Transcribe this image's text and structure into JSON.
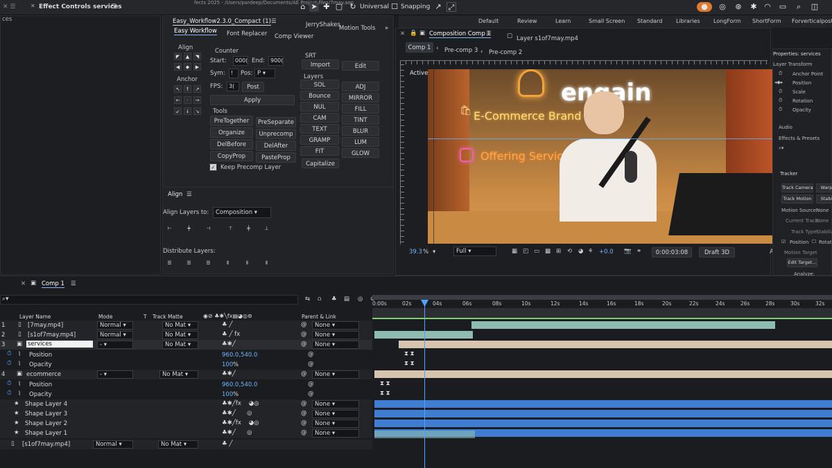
{
  "topbar": {
    "panel_title": "Effect Controls services",
    "tools": [
      "selection-tool",
      "hand-tool",
      "zoom-tool",
      "orbit-tool",
      "pen-tool",
      "rect-tool"
    ],
    "universal": "Universal",
    "snapping": "Snapping",
    "path": "fects 2025 - /Users/pardeep/Documents/AE Project files/7may.aep",
    "effects_left": "ces"
  },
  "workspaces": [
    "Default",
    "Review",
    "Learn",
    "Small Screen",
    "Standard",
    "Libraries",
    "LongForm",
    "ShortForm",
    "Forverticalpost"
  ],
  "workflow": {
    "title": "Easy_Workflow2.3.0_Compact (1)",
    "tab_jerry": "JerryShakes",
    "tab_motion": "Motion Tools",
    "tabs": [
      "Easy Workflow",
      "Font Replacer",
      "Comp Viewer"
    ],
    "align_label": "Align",
    "anchor_label": "Anchor",
    "counter_label": "Counter",
    "start_label": "Start:",
    "start_val": "000(",
    "end_label": "End:",
    "end_val": "900(",
    "sym_label": "Sym:",
    "sym_val": "!",
    "pos_label": "Pos:",
    "pos_val": "P",
    "fps_label": "FPS:",
    "fps_val": "3(",
    "post": "Post",
    "apply": "Apply",
    "tools_label": "Tools",
    "tool_buttons": [
      "PreTogether",
      "PreSeparate",
      "Organize",
      "Unprecomp",
      "DelBefore",
      "DelAfter",
      "CopyProp",
      "PasteProp"
    ],
    "keep_precomp": "Keep Precomp Layer",
    "srt_label": "SRT",
    "import": "Import",
    "edit": "Edit",
    "layers_label": "Layers",
    "layer_buttons": [
      "SOL",
      "ADJ",
      "Bounce",
      "MIRROR",
      "NUL",
      "FILL",
      "CAM",
      "TINT",
      "TEXT",
      "BLUR",
      "GRAMP",
      "LUM",
      "FIT",
      "GLOW",
      "Capitalize"
    ]
  },
  "align_panel": {
    "title": "Align",
    "align_to_label": "Align Layers to:",
    "align_to_value": "Composition",
    "distribute_label": "Distribute Layers:"
  },
  "composition": {
    "panel_title": "Composition Comp 1",
    "layer_panel": "Layer s1of7may.mp4",
    "tabs": [
      "Comp 1",
      "Pre-comp 3",
      "Pre-comp 2"
    ],
    "active_camera": "Active Camera (Default)",
    "overlay_brand": "engain",
    "overlay_ecommerce": "E-Commerce Brand",
    "overlay_offering": "Offering Service",
    "zoom": "39.3",
    "zoom_unit": "%",
    "resolution": "Full",
    "exposure": "+0.0",
    "timecode": "0:00:03:08",
    "renderer": "Draft 3D",
    "more": "Adv"
  },
  "right_panel": {
    "properties": "Properties: services",
    "layer_transform": "Layer Transform",
    "items": [
      "Anchor Point",
      "Position",
      "Scale",
      "Rotation",
      "Opacity"
    ],
    "audio": "Audio",
    "effects_presets": "Effects & Presets",
    "tracker": "Tracker",
    "track_camera": "Track Camera",
    "warp": "Warp",
    "track_motion": "Track Motion",
    "stabilize": "Stabi",
    "motion_source_label": "Motion Source:",
    "motion_source": "None",
    "current_track_label": "Current Track:",
    "current_track": "None",
    "track_type_label": "Track Type:",
    "track_type": "Stabilize",
    "position_cb": "Position",
    "rotation_cb": "Rotatio",
    "motion_target": "Motion Target",
    "edit_target": "Edit Target...",
    "analyze": "Analyze:"
  },
  "timeline": {
    "comp_tab": "Comp 1",
    "headers": {
      "layer_name": "Layer Name",
      "mode": "Mode",
      "t": "T",
      "track_matte": "Track Matte",
      "parent": "Parent & Link"
    },
    "ruler": [
      "0:00s",
      "02s",
      "04s",
      "06s",
      "08s",
      "10s",
      "12s",
      "14s",
      "16s",
      "18s",
      "20s",
      "22s",
      "24s",
      "26s",
      "28s",
      "30s",
      "32s"
    ],
    "rows": [
      {
        "num": "1",
        "name": "[7may.mp4]",
        "mode": "Normal",
        "matte": "No Mat",
        "parent": "None"
      },
      {
        "num": "2",
        "name": "[s1of7may.mp4]",
        "mode": "Normal",
        "matte": "No Mat",
        "parent": "None"
      },
      {
        "num": "3",
        "name": "services",
        "mode": "-",
        "matte": "No Mat",
        "parent": "None"
      },
      {
        "num": "",
        "name": "Position",
        "value": "960.0,540.0"
      },
      {
        "num": "",
        "name": "Opacity",
        "value": "100",
        "unit": "%"
      },
      {
        "num": "4",
        "name": "ecommerce",
        "mode": "-",
        "matte": "No Mat",
        "parent": "None"
      },
      {
        "num": "",
        "name": "Position",
        "value": "960.0,540.0"
      },
      {
        "num": "",
        "name": "Opacity",
        "value": "100",
        "unit": "%"
      },
      {
        "num": "5",
        "name": "Shape Layer 4",
        "parent": "None"
      },
      {
        "num": "6",
        "name": "Shape Layer 3",
        "parent": "None"
      },
      {
        "num": "7",
        "name": "Shape Layer 2",
        "parent": "None"
      },
      {
        "num": "8",
        "name": "Shape Layer 1",
        "parent": "None"
      },
      {
        "num": "9",
        "name": "[s1of7may.mp4]",
        "mode": "Normal",
        "matte": "No Mat"
      }
    ]
  }
}
